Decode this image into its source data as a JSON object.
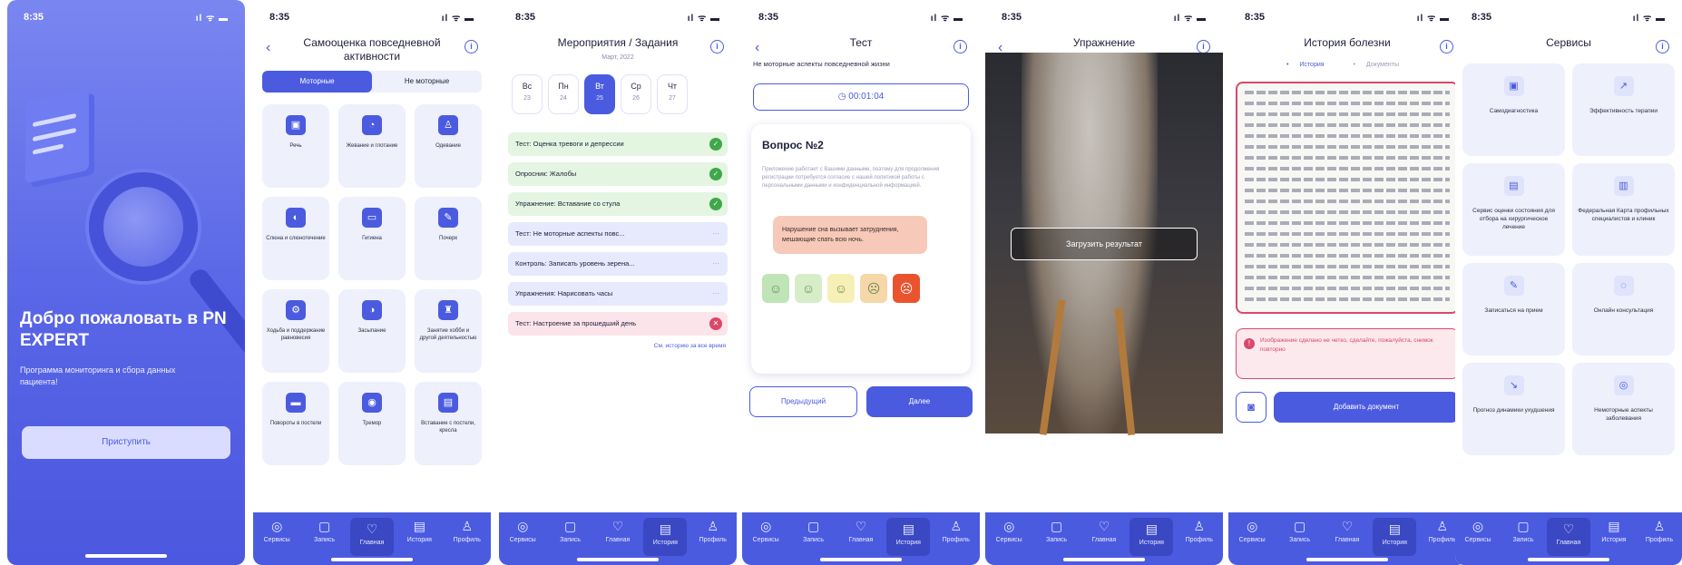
{
  "status": {
    "time": "8:35",
    "signal": "ıl ᯤ ▬"
  },
  "tabs": [
    {
      "label": "Сервисы",
      "icon": "◎"
    },
    {
      "label": "Запись",
      "icon": "▢"
    },
    {
      "label": "Главная",
      "icon": "♡"
    },
    {
      "label": "История",
      "icon": "▤"
    },
    {
      "label": "Профиль",
      "icon": "♙"
    }
  ],
  "onboarding": {
    "title": "Добро пожаловать в PN EXPERT",
    "subtitle": "Программа мониторинга и сбора данных пациента!",
    "button": "Приступить"
  },
  "self_assessment": {
    "title": "Самооценка повседневной активности",
    "segments": [
      "Моторные",
      "Не моторные"
    ],
    "cards": [
      {
        "icon": "▣",
        "label": "Речь"
      },
      {
        "icon": "◔",
        "label": "Жевание и глотание"
      },
      {
        "icon": "♙",
        "label": "Одевание"
      },
      {
        "icon": "◐",
        "label": "Слюна и слюнотечение"
      },
      {
        "icon": "▭",
        "label": "Гигиена"
      },
      {
        "icon": "✎",
        "label": "Почерк"
      },
      {
        "icon": "⚙",
        "label": "Ходьба и поддержание равновесия"
      },
      {
        "icon": "◑",
        "label": "Засыпание"
      },
      {
        "icon": "♜",
        "label": "Занятие хобби и другой деятельностью"
      },
      {
        "icon": "▬",
        "label": "Повороты в постели"
      },
      {
        "icon": "◉",
        "label": "Тремор"
      },
      {
        "icon": "▤",
        "label": "Вставание с постели, кресла"
      }
    ]
  },
  "events": {
    "title": "Мероприятия / Задания",
    "month": "Март, 2022",
    "days": [
      {
        "name": "Вс",
        "num": "23"
      },
      {
        "name": "Пн",
        "num": "24"
      },
      {
        "name": "Вт",
        "num": "25"
      },
      {
        "name": "Ср",
        "num": "26"
      },
      {
        "name": "Чт",
        "num": "27"
      }
    ],
    "tasks": [
      {
        "label": "Тест: Оценка тревоги и депрессии",
        "state": "done",
        "mark": "✓"
      },
      {
        "label": "Опросник: Жалобы",
        "state": "done",
        "mark": "✓"
      },
      {
        "label": "Упражнение: Вставание со стула",
        "state": "done",
        "mark": "✓"
      },
      {
        "label": "Тест: Не моторные аспекты повс...",
        "state": "pend",
        "mark": "⋯"
      },
      {
        "label": "Контроль: Записать уровень зерена...",
        "state": "pend",
        "mark": "⋯"
      },
      {
        "label": "Упражнения: Нарисовать часы",
        "state": "pend",
        "mark": "⋯"
      },
      {
        "label": "Тест: Настроение за прошедший день",
        "state": "bad",
        "mark": "✕"
      }
    ],
    "history_link": "См. историю за все время"
  },
  "test": {
    "title": "Тест",
    "subtitle": "Не моторные аспекты повседневной жизни",
    "timer": "00:01:04",
    "question_title": "Вопрос №2",
    "question_text": "Приложение работает с Вашими данными, поэтому для продолжения регистрации потребуется согласие с нашей политикой работы с персональными данными и конфиденциальной информацией.",
    "answer": "Нарушение сна вызывает затруднения, мешающие спать всю ночь.",
    "faces": [
      "☺",
      "☺",
      "☺",
      "☹",
      "☹"
    ],
    "face_colors": [
      "#bfe5b6",
      "#d7edc8",
      "#f6f0b6",
      "#f6d7a8",
      "#e9542f"
    ],
    "prev": "Предыдущий",
    "next": "Далее"
  },
  "exercise": {
    "title": "Упражнение",
    "upload": "Загрузить результат"
  },
  "history": {
    "title": "История болезни",
    "tabs": [
      "История",
      "Документы"
    ],
    "alert": "Изображение сделано не четко, сделайте, пожалуйста, снимок повторно",
    "add_button": "Добавить документ"
  },
  "services": {
    "title": "Сервисы",
    "cards": [
      {
        "icon": "▣",
        "label": "Самодиагностика"
      },
      {
        "icon": "↗",
        "label": "Эффективность терапии"
      },
      {
        "icon": "▤",
        "label": "Сервис оценки состояния для отбора на хирургическое лечение"
      },
      {
        "icon": "▥",
        "label": "Федеральная Карта профильных специалистов и клиник"
      },
      {
        "icon": "✎",
        "label": "Записаться на прием"
      },
      {
        "icon": "◌",
        "label": "Онлайн консультация"
      },
      {
        "icon": "↘",
        "label": "Прогноз динамики ухудшения"
      },
      {
        "icon": "◎",
        "label": "Немоторные аспекты заболевания"
      }
    ]
  },
  "colors": {
    "accent": "#4b5be0",
    "success": "#3fa84a",
    "error": "#d9486a"
  }
}
